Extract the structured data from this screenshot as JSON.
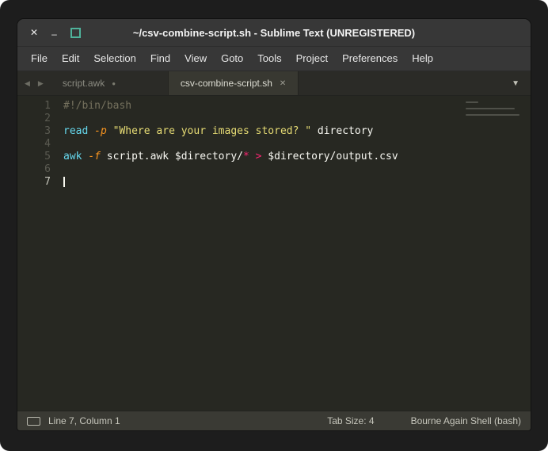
{
  "window": {
    "title": "~/csv-combine-script.sh - Sublime Text (UNREGISTERED)",
    "controls": {
      "close": "✕",
      "minimize": "–"
    }
  },
  "menu": {
    "items": [
      "File",
      "Edit",
      "Selection",
      "Find",
      "View",
      "Goto",
      "Tools",
      "Project",
      "Preferences",
      "Help"
    ]
  },
  "tab_bar": {
    "scroll_left": "◀",
    "scroll_right": "▶",
    "overflow": "▼",
    "tabs": [
      {
        "label": "script.awk",
        "active": false,
        "modified": true
      },
      {
        "label": "csv-combine-script.sh",
        "active": true,
        "modified": false
      }
    ]
  },
  "editor": {
    "cursor_line": 7,
    "cursor_col": 1,
    "colors": {
      "comment": "#75715e",
      "keyword": "#66d9ef",
      "flag": "#fd971f",
      "string": "#e6db74",
      "operator": "#f92672",
      "plain": "#f8f8f2"
    },
    "lines": [
      [
        {
          "c": "comment",
          "t": "#!/bin/bash"
        }
      ],
      [],
      [
        {
          "c": "keyword",
          "t": "read"
        },
        {
          "c": "plain",
          "t": " "
        },
        {
          "c": "flag",
          "t": "-p"
        },
        {
          "c": "plain",
          "t": " "
        },
        {
          "c": "string",
          "t": "\"Where are your images stored? \""
        },
        {
          "c": "plain",
          "t": " directory"
        }
      ],
      [],
      [
        {
          "c": "keyword",
          "t": "awk"
        },
        {
          "c": "plain",
          "t": " "
        },
        {
          "c": "flag",
          "t": "-f"
        },
        {
          "c": "plain",
          "t": " script.awk $directory/"
        },
        {
          "c": "operator",
          "t": "*"
        },
        {
          "c": "plain",
          "t": " "
        },
        {
          "c": "operator",
          "t": ">"
        },
        {
          "c": "plain",
          "t": " $directory/output.csv"
        }
      ],
      [],
      []
    ],
    "minimap_widths": [
      16,
      0,
      62,
      0,
      68,
      0,
      0
    ]
  },
  "status_bar": {
    "position": "Line 7, Column 1",
    "tab_size": "Tab Size: 4",
    "syntax": "Bourne Again Shell (bash)"
  }
}
